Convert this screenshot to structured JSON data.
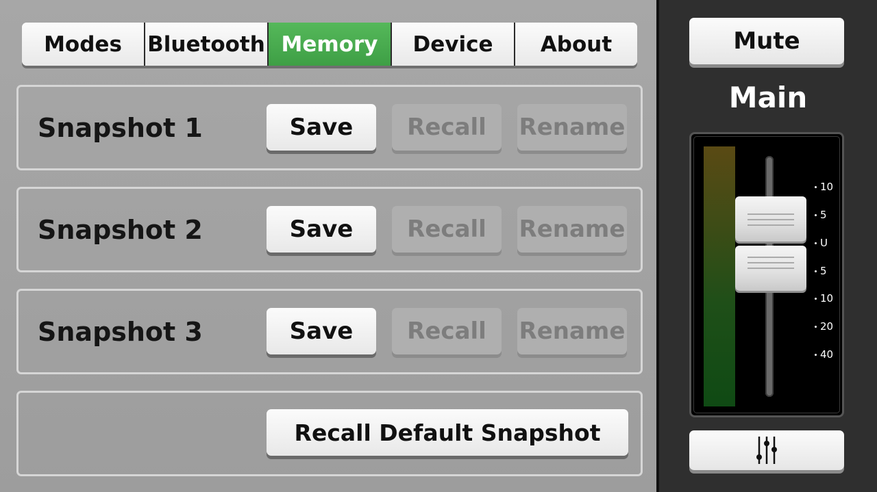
{
  "tabs": [
    {
      "label": "Modes",
      "active": false
    },
    {
      "label": "Bluetooth",
      "active": false
    },
    {
      "label": "Memory",
      "active": true
    },
    {
      "label": "Device",
      "active": false
    },
    {
      "label": "About",
      "active": false
    }
  ],
  "snapshots": [
    {
      "label": "Snapshot 1",
      "save": "Save",
      "recall": "Recall",
      "rename": "Rename"
    },
    {
      "label": "Snapshot 2",
      "save": "Save",
      "recall": "Recall",
      "rename": "Rename"
    },
    {
      "label": "Snapshot 3",
      "save": "Save",
      "recall": "Recall",
      "rename": "Rename"
    }
  ],
  "default_snapshot": {
    "label": "Recall Default Snapshot"
  },
  "right_panel": {
    "mute_label": "Mute",
    "channel_label": "Main",
    "scale": [
      "10",
      "5",
      "U",
      "5",
      "10",
      "20",
      "40"
    ],
    "mixer_icon": "mixer-sliders-icon"
  },
  "colors": {
    "accent": "#47a94d",
    "background": "#a3a3a3",
    "sidebar": "#2f2f2f"
  }
}
